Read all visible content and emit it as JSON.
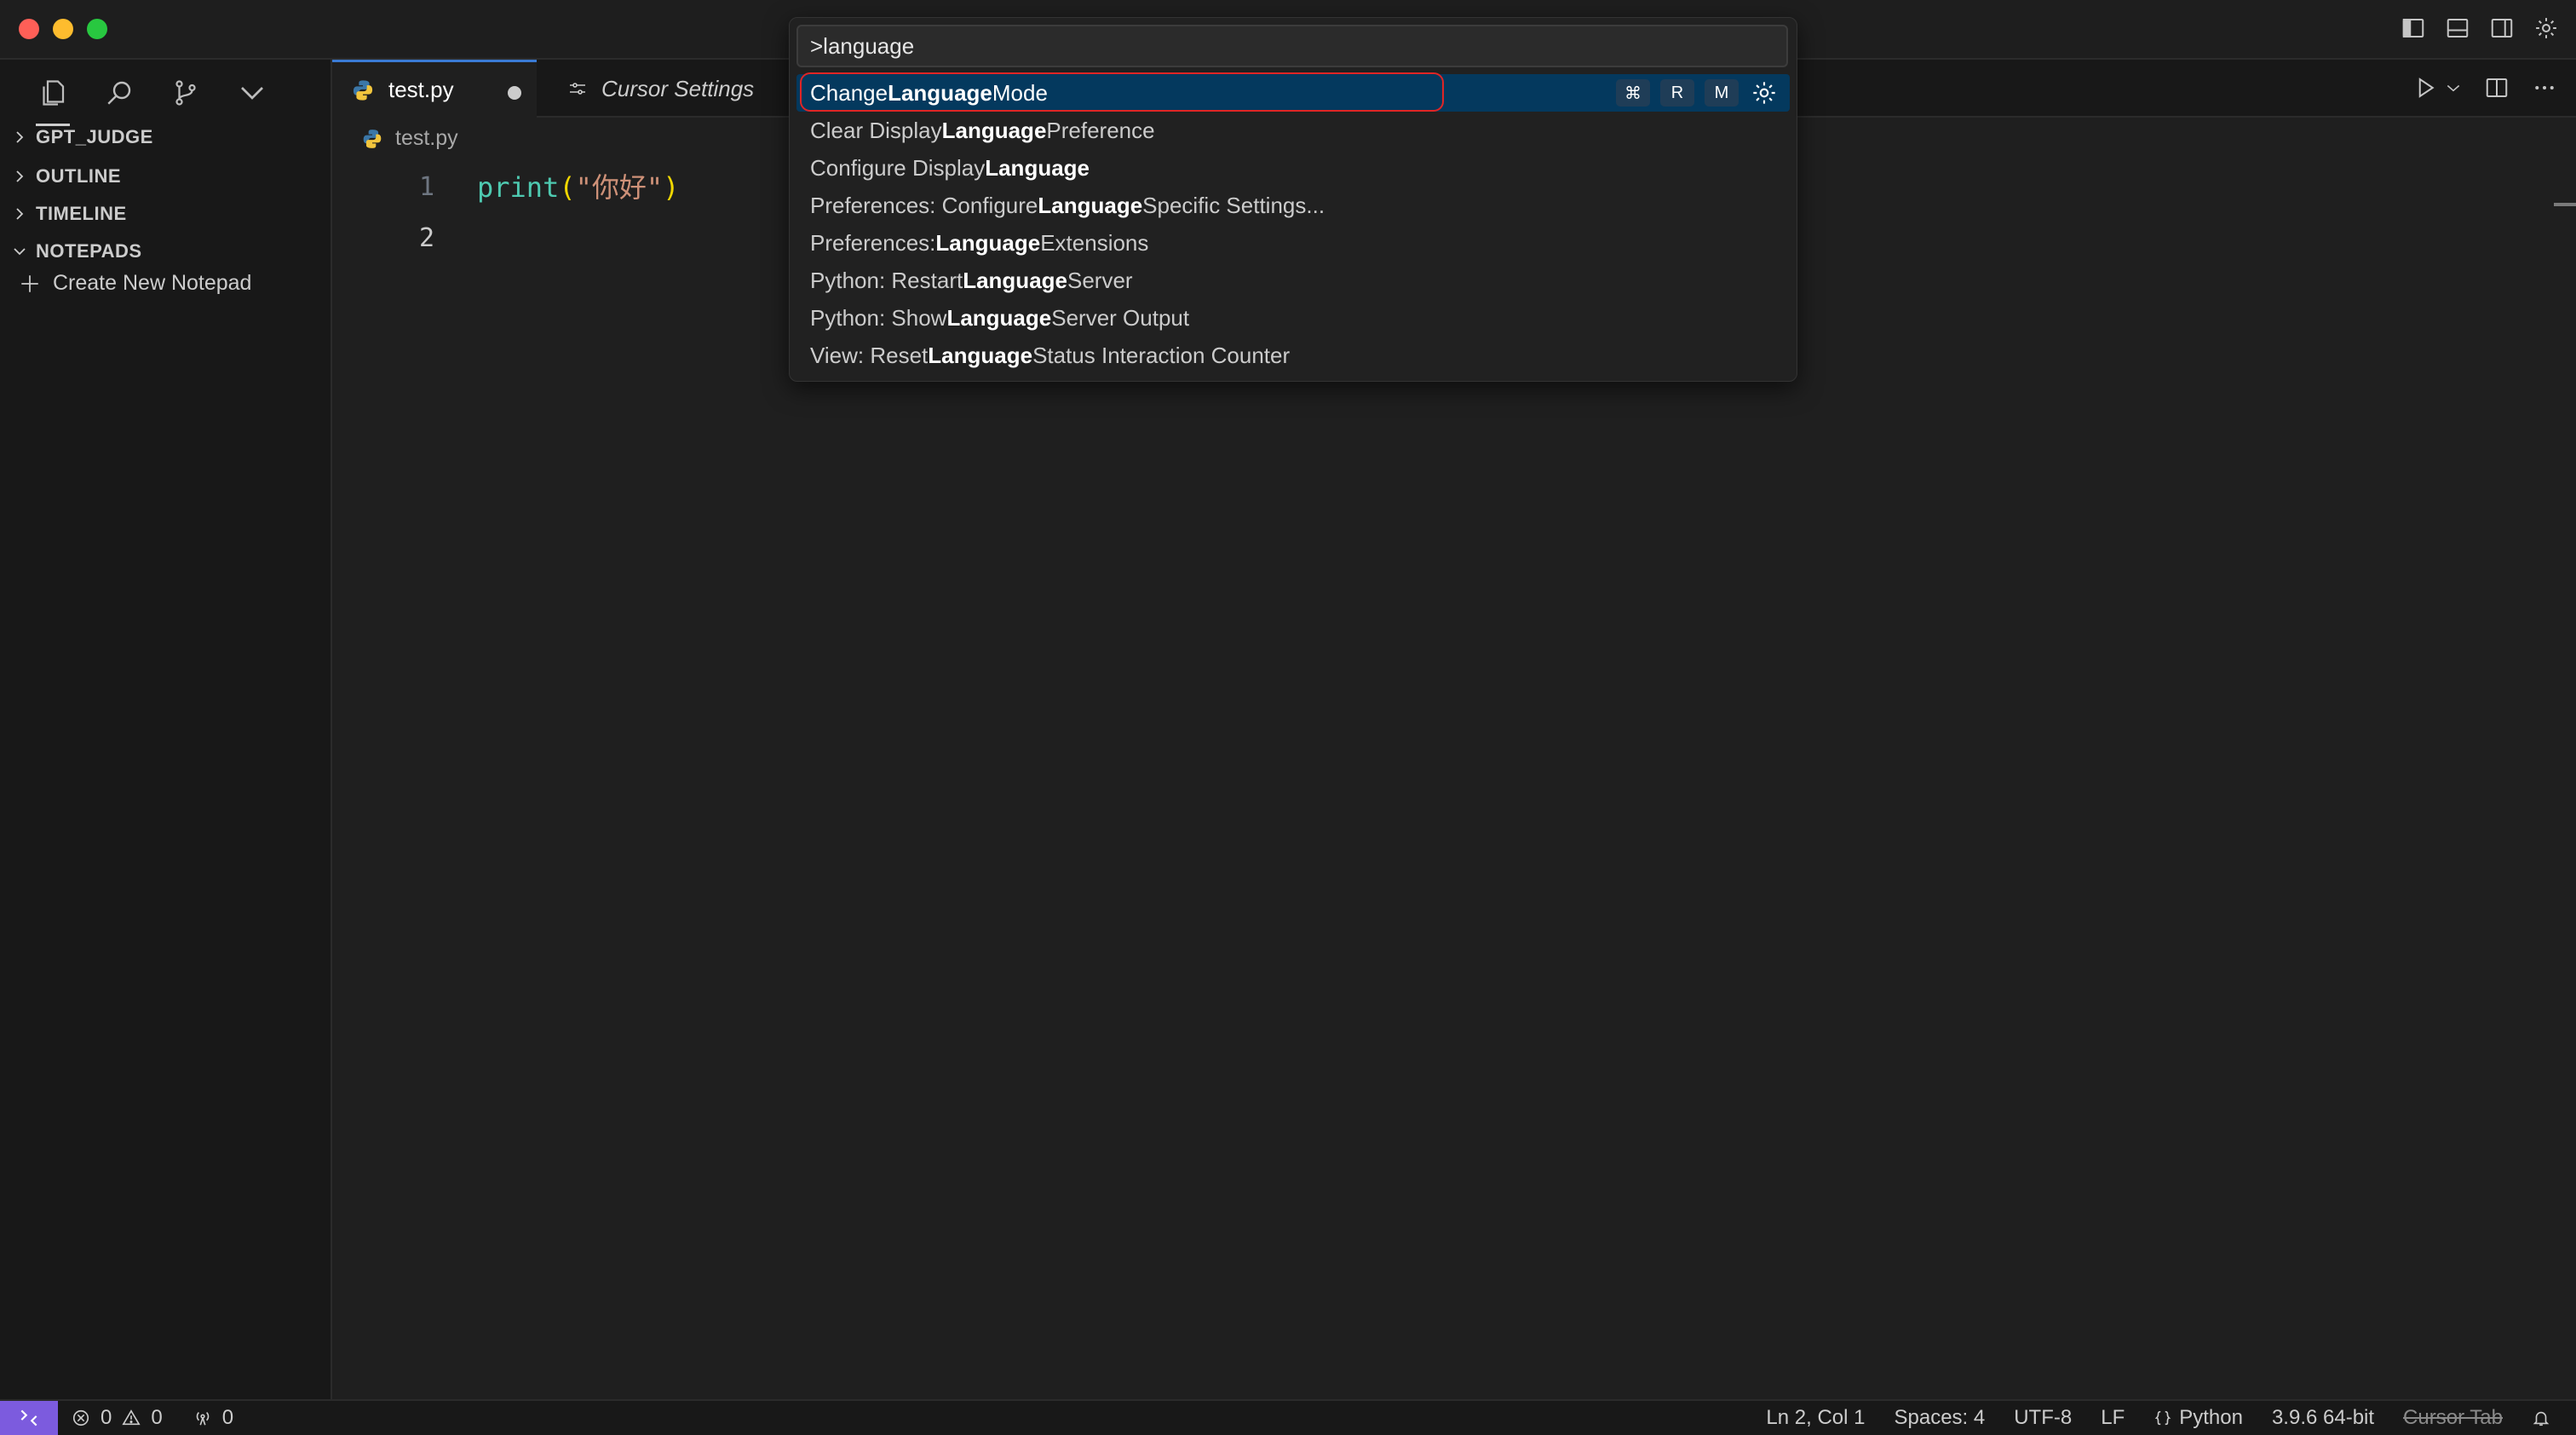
{
  "tabs": [
    {
      "label": "test.py",
      "dirty": true
    },
    {
      "label": "Cursor Settings"
    }
  ],
  "sidebar": {
    "sections": [
      {
        "label": "GPT_JUDGE",
        "expanded": false
      },
      {
        "label": "OUTLINE",
        "expanded": false
      },
      {
        "label": "TIMELINE",
        "expanded": false
      },
      {
        "label": "NOTEPADS",
        "expanded": true
      }
    ],
    "create_notepad": "Create New Notepad"
  },
  "editor": {
    "breadcrumb": "test.py",
    "line_numbers": [
      "1",
      "2"
    ],
    "code": {
      "fn": "print",
      "open": "(",
      "str": "\"你好\"",
      "close": ")"
    }
  },
  "palette": {
    "query": ">language",
    "items": [
      {
        "pre": "Change ",
        "hl": "Language",
        "post": " Mode",
        "selected": true
      },
      {
        "pre": "Clear Display ",
        "hl": "Language",
        "post": " Preference"
      },
      {
        "pre": "Configure Display ",
        "hl": "Language",
        "post": ""
      },
      {
        "pre": "Preferences: Configure ",
        "hl": "Language",
        "post": " Specific Settings..."
      },
      {
        "pre": "Preferences: ",
        "hl": "Language",
        "post": " Extensions"
      },
      {
        "pre": "Python: Restart ",
        "hl": "Language",
        "post": " Server"
      },
      {
        "pre": "Python: Show ",
        "hl": "Language",
        "post": " Server Output"
      },
      {
        "pre": "View: Reset ",
        "hl": "Language",
        "post": " Status Interaction Counter"
      }
    ],
    "keybinding": [
      "⌘",
      "R",
      "M"
    ]
  },
  "statusbar": {
    "errors": "0",
    "warnings": "0",
    "ports": "0",
    "position": "Ln 2, Col 1",
    "spaces": "Spaces: 4",
    "encoding": "UTF-8",
    "eol": "LF",
    "language": "Python",
    "interpreter": "3.9.6 64-bit",
    "cursor_tab": "Cursor Tab"
  },
  "colors": {
    "accent": "#3a7bd5",
    "selection": "#04395e",
    "remote": "#7c5bde",
    "highlight_ring": "#e02525"
  }
}
